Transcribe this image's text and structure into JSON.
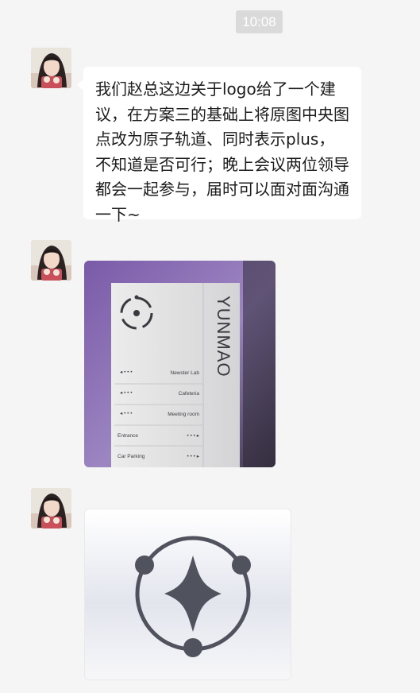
{
  "chat": {
    "timestamp": "10:08",
    "messages": [
      {
        "sender_glyph": "",
        "type": "text",
        "text": "我们赵总这边关于logo给了一个建议，在方案三的基础上将原图中央图点改为原子轨道、同时表示plus，不知道是否可行；晚上会议两位领导都会一起参与，届时可以面对面沟通一下~"
      },
      {
        "sender_glyph": "",
        "type": "image",
        "image": {
          "brand": "YUNMAO",
          "sign_rows": [
            {
              "text": "Newster Lab",
              "side": "right"
            },
            {
              "text": "Cafeteria",
              "side": "right"
            },
            {
              "text": "Meeting room",
              "side": "right"
            },
            {
              "text": "Entrance",
              "side": "left"
            },
            {
              "text": "Car Parking",
              "side": "left"
            }
          ]
        }
      },
      {
        "sender_glyph": "",
        "type": "image",
        "image": {
          "subject": "atom-plus-logo"
        }
      }
    ]
  },
  "colors": {
    "background": "#f5f5f5",
    "bubble": "#ffffff",
    "time_pill": "#dadada",
    "logo_dark": "#50525e",
    "photo_purple": "#7a5aa8"
  }
}
